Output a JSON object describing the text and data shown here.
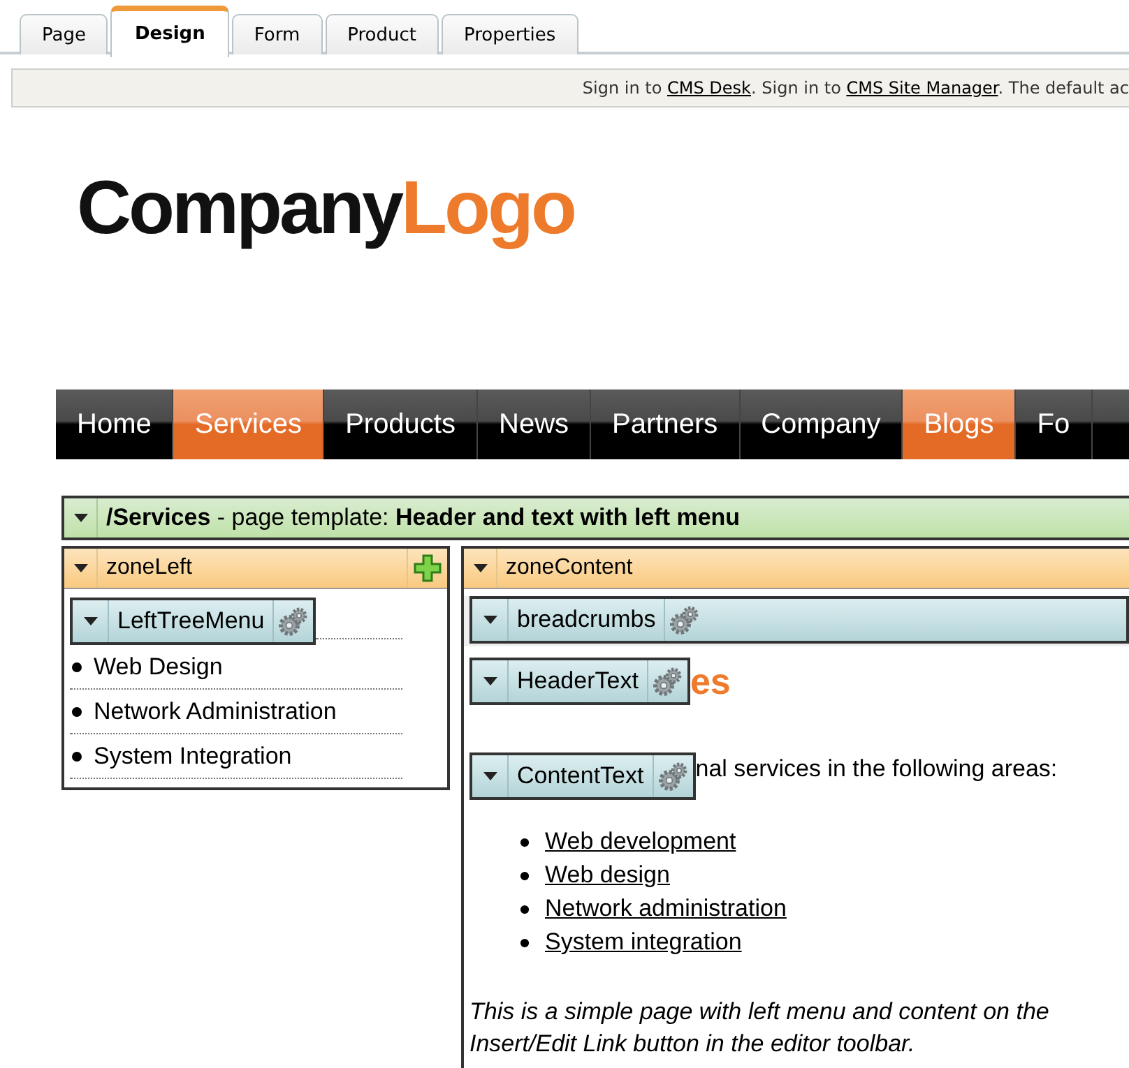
{
  "tabs": [
    {
      "label": "Page",
      "selected": false
    },
    {
      "label": "Design",
      "selected": true
    },
    {
      "label": "Form",
      "selected": false
    },
    {
      "label": "Product",
      "selected": false
    },
    {
      "label": "Properties",
      "selected": false
    }
  ],
  "info_bar": {
    "segments": [
      {
        "kind": "text",
        "text": "Sign in to "
      },
      {
        "kind": "link",
        "text": "CMS Desk"
      },
      {
        "kind": "text",
        "text": ". Sign in to "
      },
      {
        "kind": "link",
        "text": "CMS Site Manager"
      },
      {
        "kind": "text",
        "text": ". The default ac"
      }
    ]
  },
  "logo": {
    "parts": [
      {
        "kind": "dark",
        "text": "Company"
      },
      {
        "kind": "accent",
        "text": "Logo"
      }
    ]
  },
  "nav": [
    {
      "label": "Home",
      "selected": false
    },
    {
      "label": "Services",
      "selected": true
    },
    {
      "label": "Products",
      "selected": false
    },
    {
      "label": "News",
      "selected": false
    },
    {
      "label": "Partners",
      "selected": false
    },
    {
      "label": "Company",
      "selected": false
    },
    {
      "label": "Blogs",
      "selected": true
    },
    {
      "label": "Fo",
      "selected": false
    }
  ],
  "page_template": {
    "expanded": true,
    "text": "**/Services** - page template: **Header and text with left menu**"
  },
  "zone_left": {
    "title": "zoneLeft",
    "expanded": true,
    "web_part": {
      "name": "LeftTreeMenu",
      "expanded": true
    },
    "items": [
      "Web Design",
      "Network Administration",
      "System Integration"
    ]
  },
  "zone_content": {
    "title": "zoneContent",
    "expanded": true,
    "breadcrumbs": {
      "name": "breadcrumbs",
      "expanded": true
    },
    "header_part": {
      "name": "HeaderText",
      "expanded": true
    },
    "heading_fragment": "es",
    "content_part": {
      "name": "ContentText",
      "expanded": true
    },
    "intro_fragment": "nal services in the following areas:",
    "links": [
      "Web development",
      "Web design",
      "Network administration",
      "System integration"
    ],
    "note_lines": [
      "This is a simple page with left menu and content on the",
      "Insert/Edit Link button in the editor toolbar."
    ]
  }
}
